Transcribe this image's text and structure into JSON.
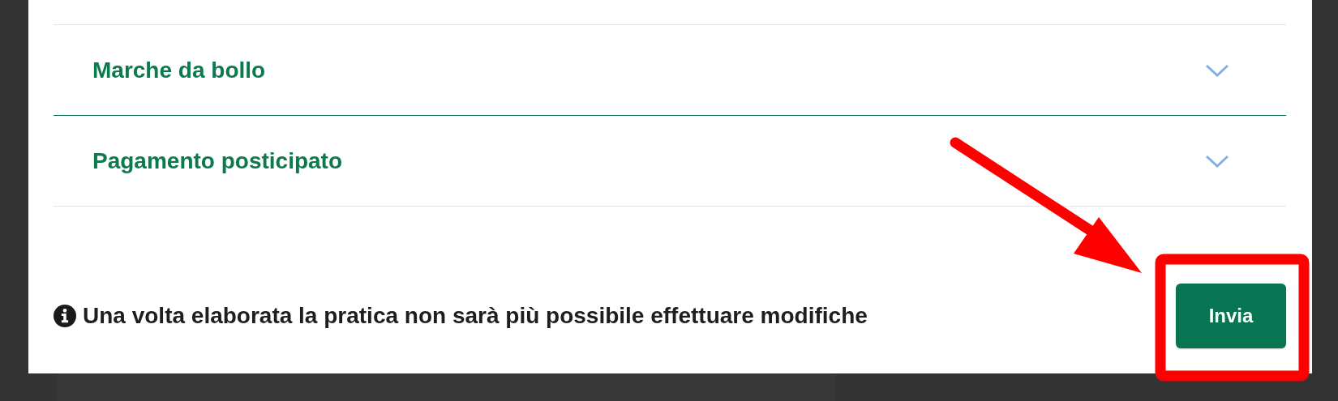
{
  "sections": [
    {
      "title": "Marche da bollo",
      "expanded": false,
      "highlighted": true
    },
    {
      "title": "Pagamento posticipato",
      "expanded": false,
      "highlighted": false
    }
  ],
  "notice": "Una volta elaborata la pratica non sarà più possibile effettuare modifiche",
  "submit_button": "Invia"
}
